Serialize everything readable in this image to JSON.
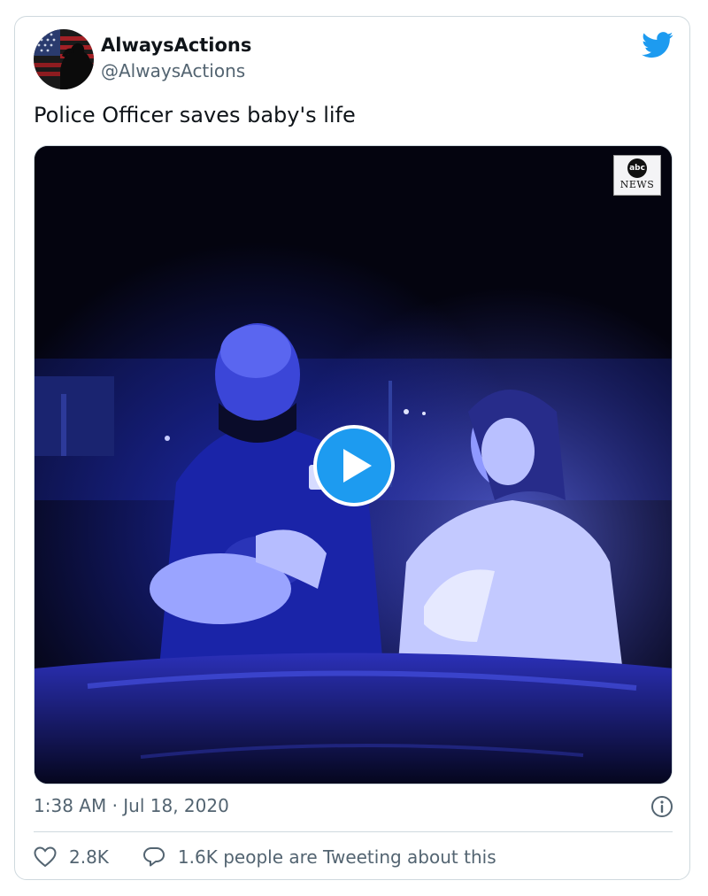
{
  "author": {
    "name": "AlwaysActions",
    "handle": "@AlwaysActions"
  },
  "tweet": {
    "text": "Police Officer saves baby's life",
    "timestamp": "1:38 AM · Jul 18, 2020"
  },
  "media": {
    "type": "video",
    "logo_top": "abc",
    "logo_bottom": "NEWS"
  },
  "stats": {
    "likes": "2.8K",
    "conversation": "1.6K people are Tweeting about this"
  },
  "icons": {
    "brand": "twitter-bird-icon",
    "play": "play-icon",
    "info": "info-icon",
    "like": "heart-icon",
    "reply": "speech-bubble-icon"
  },
  "colors": {
    "accent": "#1d9bf0",
    "text_primary": "#0f1419",
    "text_secondary": "#536471",
    "border": "#cfd9de"
  }
}
